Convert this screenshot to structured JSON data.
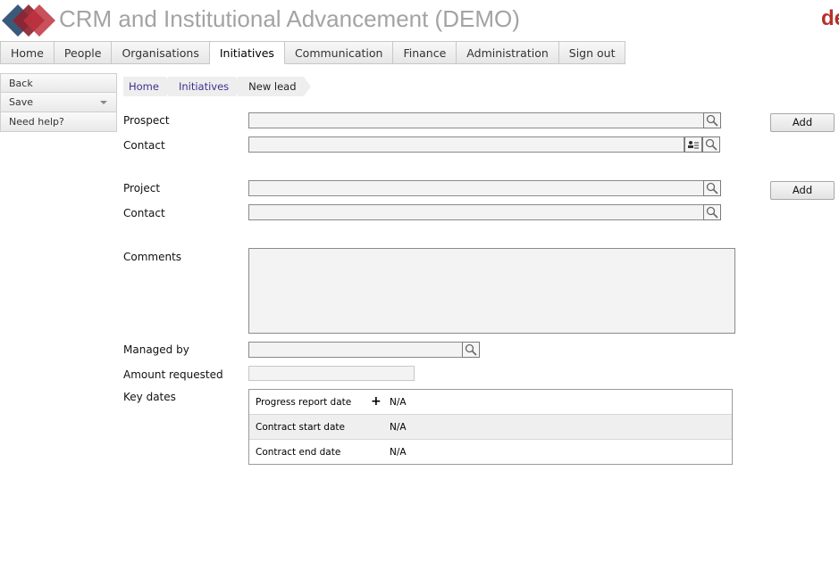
{
  "app": {
    "title": "CRM and Institutional Advancement (DEMO)",
    "brand_text": "de",
    "logo_colors": [
      "#3a5a7c",
      "#8f2330",
      "#c0323f"
    ]
  },
  "nav": {
    "tabs": [
      "Home",
      "People",
      "Organisations",
      "Initiatives",
      "Communication",
      "Finance",
      "Administration",
      "Sign out"
    ],
    "active": "Initiatives"
  },
  "actions": {
    "back": "Back",
    "save": "Save",
    "help": "Need help?"
  },
  "breadcrumb": [
    "Home",
    "Initiatives",
    "New lead"
  ],
  "form": {
    "prospect_label": "Prospect",
    "prospect_value": "",
    "prospect_contact_label": "Contact",
    "prospect_contact_value": "",
    "project_label": "Project",
    "project_value": "",
    "project_contact_label": "Contact",
    "project_contact_value": "",
    "add_label": "Add",
    "comments_label": "Comments",
    "comments_value": "",
    "managed_by_label": "Managed by",
    "managed_by_value": "",
    "amount_label": "Amount requested",
    "amount_value": "",
    "key_dates_label": "Key dates",
    "key_dates": [
      {
        "label": "Progress report date",
        "value": "N/A",
        "addable": true
      },
      {
        "label": "Contract start date",
        "value": "N/A",
        "addable": false
      },
      {
        "label": "Contract end date",
        "value": "N/A",
        "addable": false
      }
    ]
  },
  "icons": {
    "lookup": "magnifier-icon",
    "contact_card": "contact-card-icon",
    "add_date": "plus-icon",
    "menu_caret": "caret-down-icon"
  },
  "colors": {
    "accent_link": "#3d2f8f",
    "brand_red": "#b3322a",
    "title_gray": "#a3a3a3"
  }
}
